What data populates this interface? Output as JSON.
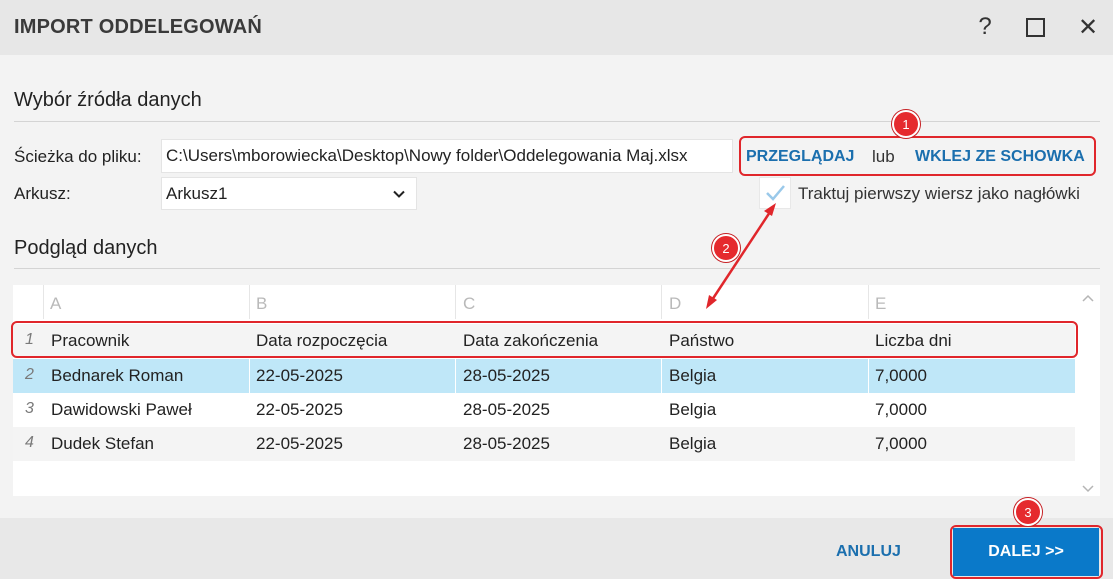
{
  "window": {
    "title": "IMPORT ODDELEGOWAŃ",
    "help_label": "?",
    "close_label": "✕"
  },
  "source": {
    "section_title": "Wybór źródła danych",
    "path_label": "Ścieżka do pliku:",
    "path_value": "C:\\Users\\mborowiecka\\Desktop\\Nowy folder\\Oddelegowania Maj.xlsx",
    "browse_label": "PRZEGLĄDAJ",
    "or_label": "lub",
    "paste_label": "WKLEJ ZE SCHOWKA",
    "sheet_label": "Arkusz:",
    "sheet_value": "Arkusz1",
    "header_checkbox_label": "Traktuj pierwszy wiersz jako nagłówki",
    "header_checkbox_checked": true
  },
  "preview": {
    "section_title": "Podgląd danych",
    "column_letters": [
      "A",
      "B",
      "C",
      "D",
      "E"
    ],
    "rows": [
      {
        "num": "1",
        "cells": [
          "Pracownik",
          "Data rozpoczęcia",
          "Data zakończenia",
          "Państwo",
          "Liczba dni"
        ]
      },
      {
        "num": "2",
        "cells": [
          "Bednarek Roman",
          "22-05-2025",
          "28-05-2025",
          "Belgia",
          "7,0000"
        ],
        "selected": true
      },
      {
        "num": "3",
        "cells": [
          "Dawidowski Paweł",
          "22-05-2025",
          "28-05-2025",
          "Belgia",
          "7,0000"
        ]
      },
      {
        "num": "4",
        "cells": [
          "Dudek Stefan",
          "22-05-2025",
          "28-05-2025",
          "Belgia",
          "7,0000"
        ]
      }
    ]
  },
  "footer": {
    "cancel_label": "ANULUJ",
    "next_label": "DALEJ >>"
  },
  "annotations": {
    "marker_1": "1",
    "marker_2": "2",
    "marker_3": "3",
    "color": "#e0262b"
  },
  "colors": {
    "accent": "#1b6fae",
    "primary_button": "#0a79c9",
    "selected_row": "#bfe7f8"
  }
}
